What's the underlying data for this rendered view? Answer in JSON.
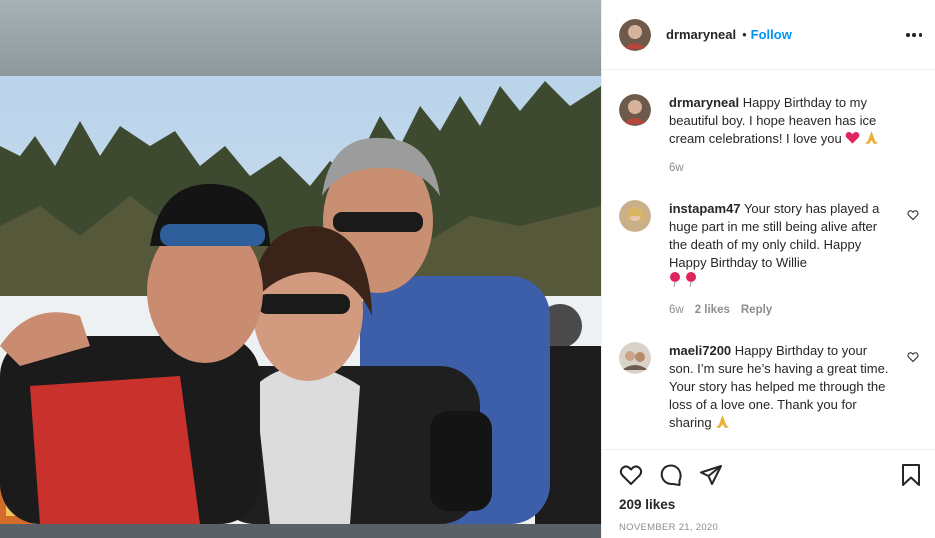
{
  "post": {
    "username": "drmaryneal",
    "separator": "•",
    "follow_label": "Follow",
    "more_icon": "more-options-icon",
    "photo_alt": "photo"
  },
  "caption": {
    "username": "drmaryneal",
    "text": "Happy Birthday to my beautiful boy. I hope heaven has ice cream celebrations! I love you",
    "emojis": [
      "red-heart",
      "folded-hands"
    ],
    "time": "6w"
  },
  "comments": [
    {
      "username": "instapam47",
      "text": "Your story has played a huge part in me still being alive after the death of my only child. Happy Happy Birthday to Willie",
      "emojis": [
        "balloon",
        "balloon"
      ],
      "time": "6w",
      "likes": "2 likes",
      "reply": "Reply"
    },
    {
      "username": "maeli7200",
      "text": "Happy Birthday to your son. I’m sure he’s having a great time. Your story has helped me through the loss of a love one. Thank you for sharing",
      "emojis": [
        "folded-hands"
      ]
    }
  ],
  "actions": {
    "icons": [
      "like-icon",
      "comment-icon",
      "share-icon",
      "save-icon"
    ],
    "likes_count": "209 likes",
    "date": "NOVEMBER 21, 2020"
  },
  "colors": {
    "link_blue": "#0095f6",
    "text": "#262626",
    "muted": "#8e8e8e",
    "divider": "#efefef"
  }
}
